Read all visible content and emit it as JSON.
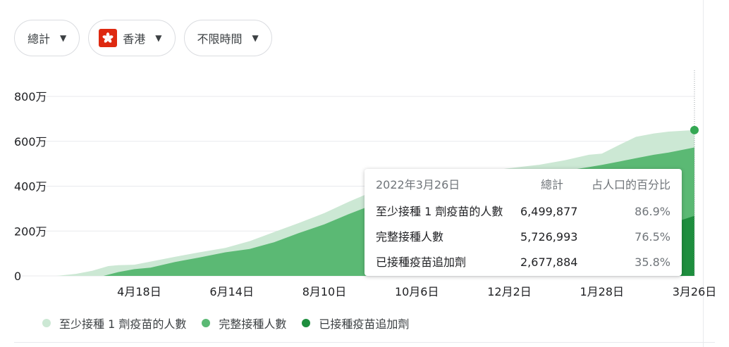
{
  "filters": {
    "metric": "總計",
    "region": "香港",
    "time_range": "不限時間"
  },
  "colors": {
    "first_dose": "#cce8d4",
    "fully": "#5bb974",
    "booster": "#1e8e3e",
    "grid": "#e8eaed"
  },
  "tooltip": {
    "date": "2022年3月26日",
    "col_total": "總計",
    "col_pct": "占人口的百分比",
    "rows": [
      {
        "label": "至少接種 1 劑疫苗的人數",
        "total": "6,499,877",
        "pct": "86.9%"
      },
      {
        "label": "完整接種人數",
        "total": "5,726,993",
        "pct": "76.5%"
      },
      {
        "label": "已接種疫苗追加劑",
        "total": "2,677,884",
        "pct": "35.8%"
      }
    ]
  },
  "chart_data": {
    "type": "area",
    "title": "",
    "xlabel": "",
    "ylabel": "",
    "ylim": [
      0,
      8000000
    ],
    "y_ticks": [
      {
        "value": 0,
        "label": "0"
      },
      {
        "value": 2000000,
        "label": "200万"
      },
      {
        "value": 4000000,
        "label": "400万"
      },
      {
        "value": 6000000,
        "label": "600万"
      },
      {
        "value": 8000000,
        "label": "800万"
      }
    ],
    "x_ticks": [
      {
        "date": "2021-04-18",
        "label": "4月18日"
      },
      {
        "date": "2021-06-14",
        "label": "6月14日"
      },
      {
        "date": "2021-08-10",
        "label": "8月10日"
      },
      {
        "date": "2021-10-06",
        "label": "10月6日"
      },
      {
        "date": "2021-12-02",
        "label": "12月2日"
      },
      {
        "date": "2022-01-28",
        "label": "1月28日"
      },
      {
        "date": "2022-03-26",
        "label": "3月26日"
      }
    ],
    "xlim": [
      "2021-02-26",
      "2022-03-26"
    ],
    "grid": true,
    "legend_position": "bottom",
    "highlight": {
      "date": "2022-03-26",
      "value": 6499877
    },
    "series": [
      {
        "name": "至少接種 1 劑疫苗的人數",
        "points": [
          [
            "2021-02-26",
            0
          ],
          [
            "2021-03-10",
            90000
          ],
          [
            "2021-03-20",
            230000
          ],
          [
            "2021-03-30",
            440000
          ],
          [
            "2021-04-05",
            480000
          ],
          [
            "2021-04-15",
            500000
          ],
          [
            "2021-04-25",
            640000
          ],
          [
            "2021-05-10",
            850000
          ],
          [
            "2021-05-25",
            1050000
          ],
          [
            "2021-06-10",
            1250000
          ],
          [
            "2021-06-25",
            1550000
          ],
          [
            "2021-07-10",
            1950000
          ],
          [
            "2021-07-25",
            2350000
          ],
          [
            "2021-08-10",
            2800000
          ],
          [
            "2021-08-25",
            3300000
          ],
          [
            "2021-09-10",
            3800000
          ],
          [
            "2021-09-20",
            4050000
          ],
          [
            "2021-10-06",
            4300000
          ],
          [
            "2021-10-25",
            4450000
          ],
          [
            "2021-11-10",
            4600000
          ],
          [
            "2021-12-02",
            4800000
          ],
          [
            "2021-12-20",
            4950000
          ],
          [
            "2022-01-05",
            5150000
          ],
          [
            "2022-01-20",
            5400000
          ],
          [
            "2022-01-28",
            5450000
          ],
          [
            "2022-02-08",
            5850000
          ],
          [
            "2022-02-18",
            6200000
          ],
          [
            "2022-03-01",
            6350000
          ],
          [
            "2022-03-10",
            6430000
          ],
          [
            "2022-03-26",
            6499877
          ]
        ]
      },
      {
        "name": "完整接種人數",
        "points": [
          [
            "2021-03-27",
            0
          ],
          [
            "2021-04-05",
            170000
          ],
          [
            "2021-04-15",
            300000
          ],
          [
            "2021-04-25",
            370000
          ],
          [
            "2021-05-10",
            620000
          ],
          [
            "2021-05-25",
            820000
          ],
          [
            "2021-06-10",
            1050000
          ],
          [
            "2021-06-25",
            1200000
          ],
          [
            "2021-07-10",
            1500000
          ],
          [
            "2021-07-25",
            1900000
          ],
          [
            "2021-08-10",
            2300000
          ],
          [
            "2021-08-25",
            2750000
          ],
          [
            "2021-09-10",
            3200000
          ],
          [
            "2021-09-20",
            3450000
          ],
          [
            "2021-10-06",
            3750000
          ],
          [
            "2021-10-25",
            3950000
          ],
          [
            "2021-11-10",
            4150000
          ],
          [
            "2021-12-02",
            4350000
          ],
          [
            "2021-12-20",
            4500000
          ],
          [
            "2022-01-05",
            4680000
          ],
          [
            "2022-01-20",
            4850000
          ],
          [
            "2022-01-28",
            4950000
          ],
          [
            "2022-02-08",
            5100000
          ],
          [
            "2022-02-18",
            5250000
          ],
          [
            "2022-03-01",
            5400000
          ],
          [
            "2022-03-10",
            5500000
          ],
          [
            "2022-03-26",
            5726993
          ]
        ]
      },
      {
        "name": "已接種疫苗追加劑",
        "points": [
          [
            "2021-11-11",
            0
          ],
          [
            "2021-12-02",
            150000
          ],
          [
            "2021-12-20",
            320000
          ],
          [
            "2022-01-05",
            600000
          ],
          [
            "2022-01-20",
            950000
          ],
          [
            "2022-01-28",
            1150000
          ],
          [
            "2022-02-08",
            1500000
          ],
          [
            "2022-02-18",
            1800000
          ],
          [
            "2022-03-01",
            2050000
          ],
          [
            "2022-03-10",
            2300000
          ],
          [
            "2022-03-26",
            2677884
          ]
        ]
      }
    ]
  }
}
